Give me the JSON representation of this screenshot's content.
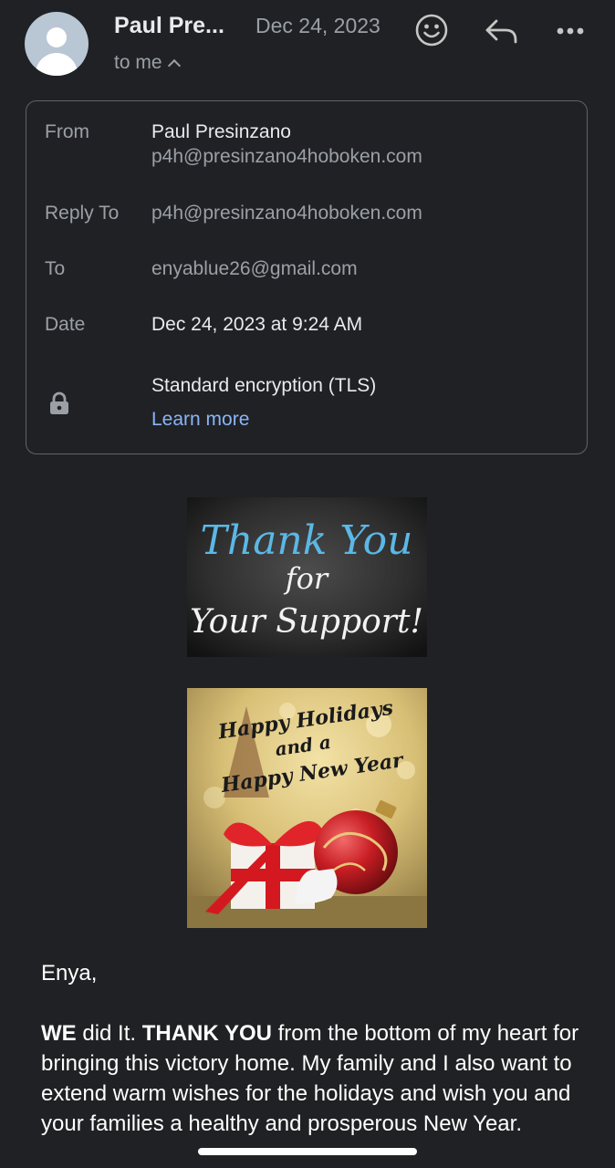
{
  "header": {
    "sender_name": "Paul Pre...",
    "date": "Dec 24, 2023",
    "recipient_summary": "to me",
    "icons": [
      "avatar",
      "emoji-icon",
      "reply-icon",
      "more-icon",
      "chevron-up-icon"
    ]
  },
  "details": {
    "from_label": "From",
    "from_name": "Paul Presinzano",
    "from_email": "p4h@presinzano4hoboken.com",
    "reply_to_label": "Reply To",
    "reply_to_value": "p4h@presinzano4hoboken.com",
    "to_label": "To",
    "to_value": "enyablue26@gmail.com",
    "date_label": "Date",
    "date_value": "Dec 24, 2023 at 9:24 AM",
    "encryption": "Standard encryption (TLS)",
    "learn_more": "Learn more",
    "icons": [
      "lock-icon"
    ]
  },
  "images": {
    "thanks_text": [
      "Thank You",
      "for",
      "Your Support!"
    ],
    "holidays_text": [
      "Happy Holidays",
      "and a",
      "Happy New Year"
    ]
  },
  "body": {
    "greeting": "Enya,",
    "p1_bold1": "WE",
    "p1_text1": " did It. ",
    "p1_bold2": "THANK YOU",
    "p1_text2": " from the bottom of my heart for bringing this victory home. My family and I also want to extend warm wishes for the holidays and wish you and your families a healthy and prosperous New Year."
  },
  "colors": {
    "background": "#202124",
    "link": "#8ab4f8",
    "chalk_blue": "#5bb8e6"
  }
}
